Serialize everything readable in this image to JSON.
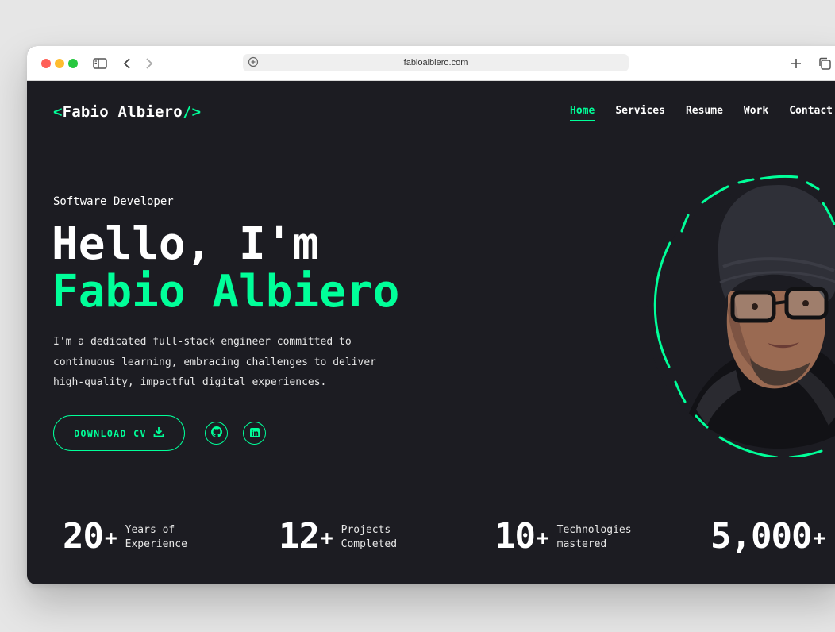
{
  "browser": {
    "url": "fabioalbiero.com"
  },
  "logo": {
    "open": "<",
    "name": "Fabio Albiero",
    "close": "/>"
  },
  "nav": {
    "items": [
      {
        "label": "Home",
        "active": true
      },
      {
        "label": "Services",
        "active": false
      },
      {
        "label": "Resume",
        "active": false
      },
      {
        "label": "Work",
        "active": false
      },
      {
        "label": "Contact",
        "active": false
      }
    ]
  },
  "hero": {
    "role": "Software Developer",
    "greeting": "Hello, I'm",
    "name": "Fabio Albiero",
    "bio_lines": [
      "I'm a dedicated full-stack engineer committed to",
      "continuous learning, embracing challenges to deliver",
      "high-quality, impactful digital experiences."
    ],
    "cv_button": "DOWNLOAD CV",
    "socials": [
      "github-icon",
      "linkedin-icon"
    ]
  },
  "stats": [
    {
      "number": "20",
      "plus": "+",
      "label_line1": "Years of",
      "label_line2": "Experience"
    },
    {
      "number": "12",
      "plus": "+",
      "label_line1": "Projects",
      "label_line2": "Completed"
    },
    {
      "number": "10",
      "plus": "+",
      "label_line1": "Technologies",
      "label_line2": "mastered"
    },
    {
      "number": "5,000",
      "plus": "+",
      "label_line1": "",
      "label_line2": ""
    }
  ],
  "colors": {
    "accent": "#00ff99",
    "background": "#1c1c22",
    "text": "#ffffff"
  }
}
